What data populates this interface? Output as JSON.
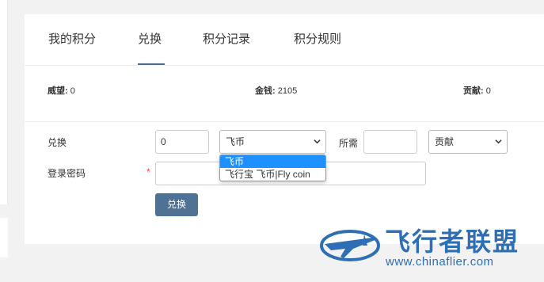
{
  "tabs": [
    {
      "label": "我的积分"
    },
    {
      "label": "兑换"
    },
    {
      "label": "积分记录"
    },
    {
      "label": "积分规则"
    }
  ],
  "stats": {
    "prestige_label": "威望:",
    "prestige_value": "0",
    "money_label": "金钱:",
    "money_value": "2105",
    "contribution_label": "贡献:",
    "contribution_value": "0"
  },
  "form": {
    "exchange_label": "兑换",
    "amount_value": "0",
    "currency_selected": "飞币",
    "required_label": "所需",
    "required_value": "",
    "target_selected": "贡献",
    "password_label": "登录密码",
    "required_star": "*",
    "password_value": "",
    "submit_label": "兑换"
  },
  "currency_options": [
    "飞币",
    "飞行宝 飞币|Fly coin"
  ],
  "watermark": {
    "title": "飞行者联盟",
    "url": "www.chinaflier.com"
  },
  "colors": {
    "accent": "#4f7193",
    "dropdown_highlight": "#1e90ff",
    "watermark": "#2e6eb5"
  }
}
